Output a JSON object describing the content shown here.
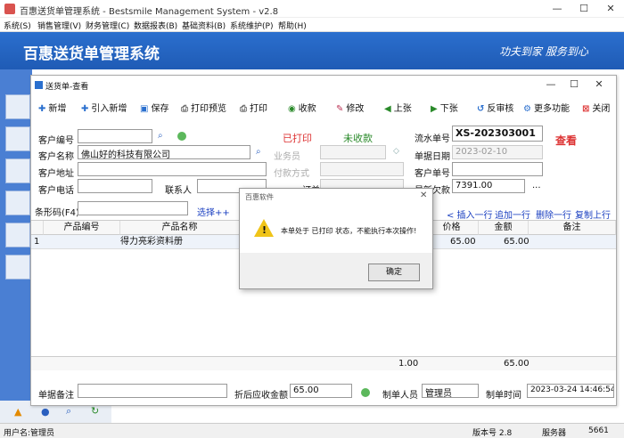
{
  "app": {
    "title": "百惠送货单管理系统 - Bestsmile Management System - v2.8",
    "banner_title": "百惠送货单管理系统",
    "slogan": "功夫到家 服务到心"
  },
  "menu": [
    "系统(S)",
    "销售管理(V)",
    "财务管理(C)",
    "数据报表(B)",
    "基础资料(B)",
    "系统维护(P)",
    "帮助(H)"
  ],
  "child": {
    "title": "送货单-查看"
  },
  "toolbar": [
    "新增",
    "引入新增",
    "保存",
    "打印预览",
    "打印",
    "收款",
    "修改",
    "上张",
    "下张",
    "反审核",
    "更多功能",
    "关闭"
  ],
  "form": {
    "customer_code_label": "客户编号",
    "customer_name_label": "客户名称",
    "customer_name": "佛山好的科技有限公司",
    "customer_addr_label": "客户地址",
    "customer_phone_label": "客户电话",
    "contact_label": "联系人",
    "printed": "已打印",
    "unpaid": "未收款",
    "salesman_label": "业务员",
    "pay_label": "付款方式",
    "order_label": "订单号码",
    "serial_label": "流水单号",
    "serial": "XS-202303001",
    "view_stamp": "查看",
    "date_label": "单据日期",
    "date": "2023-02-10",
    "cust_order_label": "客户单号",
    "debt_label": "最新欠款",
    "debt": "7391.00",
    "more": "..."
  },
  "barcode": {
    "label": "条形码(F4)",
    "select": "选择++",
    "insert_row": "< 插入一行",
    "append_row": "追加一行",
    "delete_row": "删除一行",
    "copy_row": "复制上行"
  },
  "grid": {
    "headers": [
      "产品编号",
      "产品名称",
      "价格",
      "金额",
      "备注"
    ],
    "rows": [
      {
        "no": "1",
        "name": "得力亮彩资料册",
        "price": "65.00",
        "amount": "65.00"
      }
    ],
    "total_qty": "1.00",
    "total_amount": "65.00"
  },
  "footer": {
    "remark_label": "单据备注",
    "net_label": "折后应收金额",
    "net": "65.00",
    "maker_label": "制单人员",
    "maker": "管理员",
    "time_label": "制单时间",
    "time": "2023-03-24 14:46:54"
  },
  "dialog": {
    "title": "百惠软件",
    "message": "本单处于 已打印 状态，不能执行本次操作!",
    "ok": "确定"
  },
  "status": {
    "user": "用户名:管理员",
    "version": "版本号 2.8",
    "server_label": "服务器",
    "server": "5661"
  },
  "colors": {
    "banner": "#1f5bb5",
    "printed": "#d33",
    "unpaid": "#2a8a2a",
    "link": "#1a3fc0"
  }
}
